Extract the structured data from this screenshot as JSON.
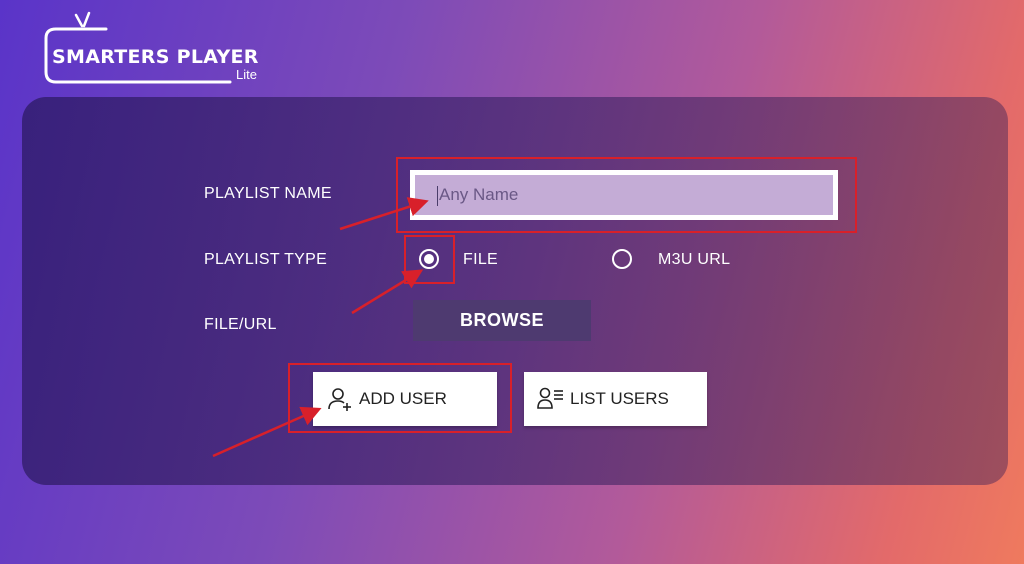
{
  "app": {
    "title": "SMARTERS PLAYER",
    "subtitle": "Lite"
  },
  "form": {
    "playlist_name_label": "PLAYLIST NAME",
    "playlist_name_placeholder": "Any Name",
    "playlist_name_value": "",
    "playlist_type_label": "PLAYLIST TYPE",
    "type_options": [
      {
        "label": "FILE",
        "selected": true
      },
      {
        "label": "M3U URL",
        "selected": false
      }
    ],
    "file_url_label": "FILE/URL",
    "browse_label": "BROWSE"
  },
  "actions": {
    "add_user_label": "ADD USER",
    "list_users_label": "LIST USERS"
  },
  "icons": {
    "logo": "tv-icon",
    "add_user": "add-user-icon",
    "list_users": "list-users-icon"
  },
  "colors": {
    "highlight": "#d8202a",
    "input_fill": "#c4acd6",
    "browse_bg": "#4e3a70"
  }
}
